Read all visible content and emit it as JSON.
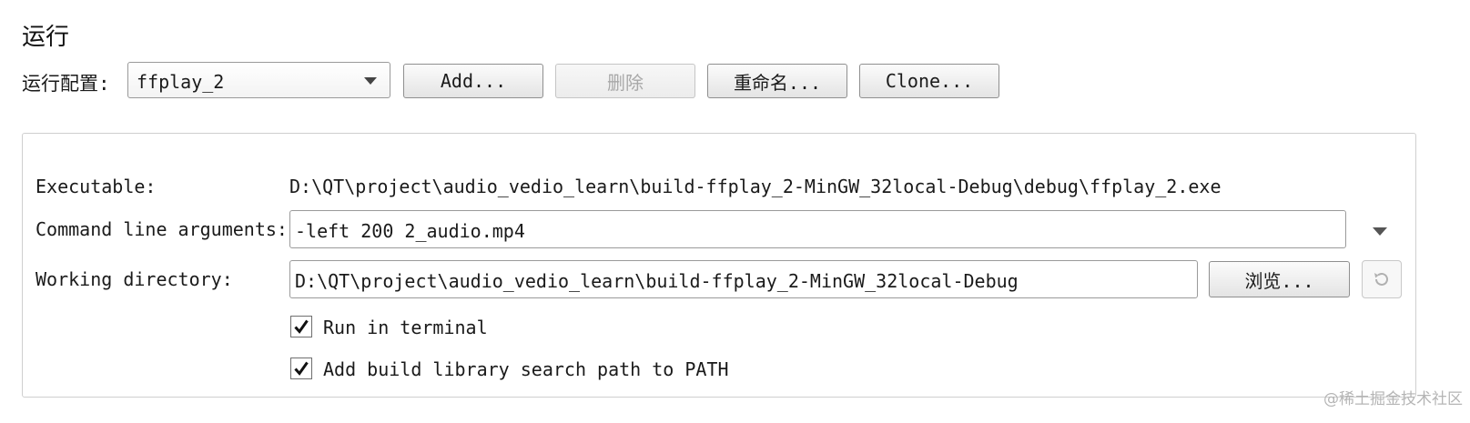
{
  "section": {
    "title": "运行"
  },
  "run_config": {
    "label": "运行配置:",
    "selected": "ffplay_2",
    "buttons": {
      "add": "Add...",
      "delete": "删除",
      "rename": "重命名...",
      "clone": "Clone..."
    }
  },
  "panel": {
    "executable": {
      "label": "Executable:",
      "value": "D:\\QT\\project\\audio_vedio_learn\\build-ffplay_2-MinGW_32local-Debug\\debug\\ffplay_2.exe"
    },
    "arguments": {
      "label": "Command line arguments:",
      "value": "-left 200 2_audio.mp4"
    },
    "working_dir": {
      "label": "Working directory:",
      "value": "D:\\QT\\project\\audio_vedio_learn\\build-ffplay_2-MinGW_32local-Debug",
      "browse": "浏览..."
    },
    "run_in_terminal": {
      "label": "Run in terminal",
      "checked": true
    },
    "add_library_path": {
      "label": "Add build library search path to PATH",
      "checked": true
    }
  },
  "watermark": "@稀土掘金技术社区",
  "icons": {
    "combo_arrow": "chevron-down-icon",
    "args_dropdown": "chevron-down-icon",
    "reset": "reset-icon",
    "checkmark": "checkmark-icon"
  }
}
